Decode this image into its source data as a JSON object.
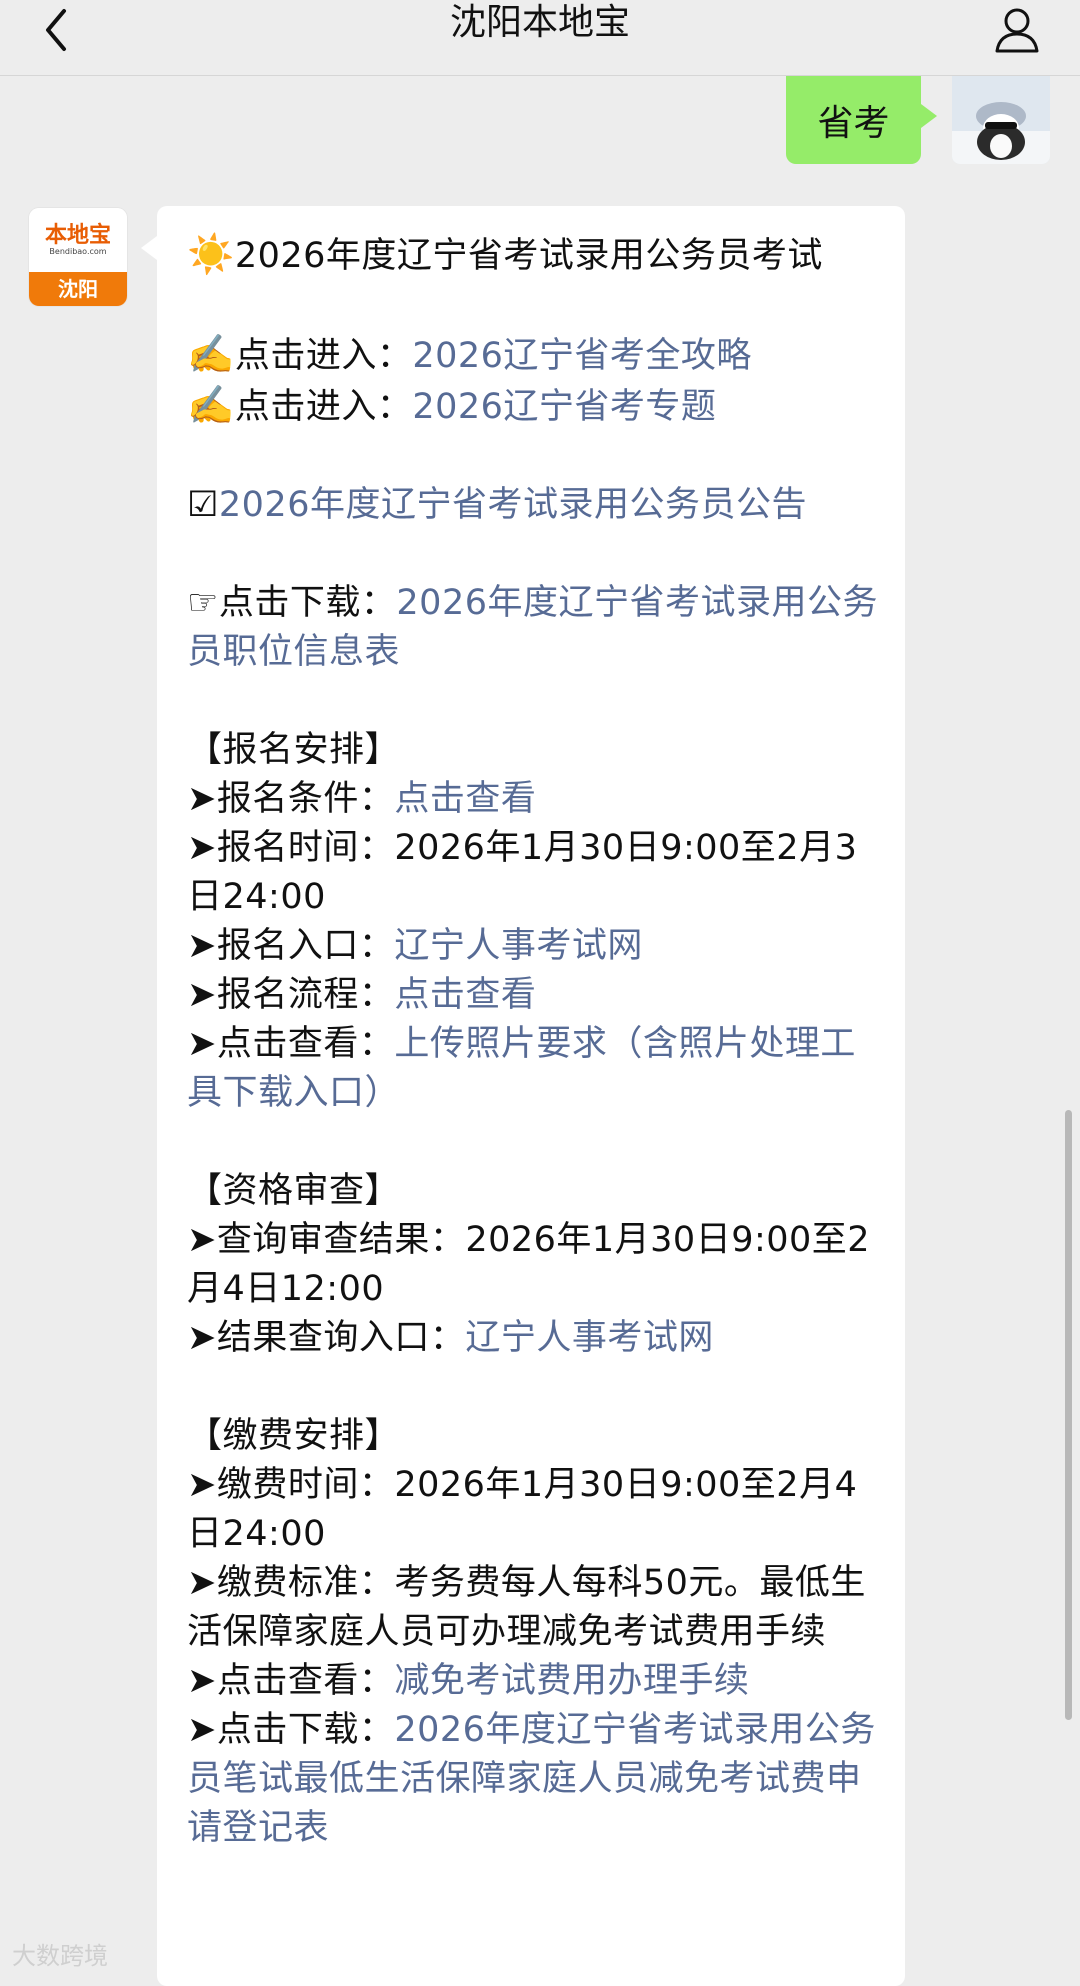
{
  "header": {
    "title": "沈阳本地宝",
    "back_icon": "chevron-left-icon",
    "profile_icon": "person-icon"
  },
  "outgoing_message": {
    "text": "省考"
  },
  "sender_logo": {
    "brand_text": "本地宝",
    "brand_sub": "Bendibao.com",
    "city": "沈阳"
  },
  "message": {
    "heading_emoji": "☀️",
    "heading": "2026年度辽宁省考试录用公务员考试",
    "enter1_emoji": "✍️",
    "enter1_label": "点击进入：",
    "enter1_link": "2026辽宁省考全攻略",
    "enter2_emoji": "✍️",
    "enter2_label": "点击进入：",
    "enter2_link": "2026辽宁省考专题",
    "notice_emoji": "☑",
    "notice_link": "2026年度辽宁省考试录用公务员公告",
    "download_emoji": "☞",
    "download_label": "点击下载：",
    "download_link": "2026年度辽宁省考试录用公务员职位信息表",
    "reg_section": "【报名安排】",
    "reg_items": [
      {
        "label": "➤报名条件：",
        "link": "点击查看",
        "text": ""
      },
      {
        "label": "➤报名时间：",
        "link": "",
        "text": "2026年1月30日9:00至2月3日24:00"
      },
      {
        "label": "➤报名入口：",
        "link": "辽宁人事考试网",
        "text": ""
      },
      {
        "label": "➤报名流程：",
        "link": "点击查看",
        "text": ""
      },
      {
        "label": "➤点击查看：",
        "link": "上传照片要求（含照片处理工具下载入口）",
        "text": ""
      }
    ],
    "qual_section": "【资格审查】",
    "qual_items": [
      {
        "label": "➤查询审查结果：",
        "link": "",
        "text": "2026年1月30日9:00至2月4日12:00"
      },
      {
        "label": "➤结果查询入口：",
        "link": "辽宁人事考试网",
        "text": ""
      }
    ],
    "fee_section": "【缴费安排】",
    "fee_items": [
      {
        "label": "➤缴费时间：",
        "link": "",
        "text": "2026年1月30日9:00至2月4日24:00"
      },
      {
        "label": "➤缴费标准：",
        "link": "",
        "text": "考务费每人每科50元。最低生活保障家庭人员可办理减免考试费用手续"
      },
      {
        "label": "➤点击查看：",
        "link": "减免考试费用办理手续",
        "text": ""
      },
      {
        "label": "➤点击下载：",
        "link": "2026年度辽宁省考试录用公务员笔试最低生活保障家庭人员减免考试费申请登记表",
        "text": ""
      }
    ]
  },
  "watermark": "大数跨境"
}
